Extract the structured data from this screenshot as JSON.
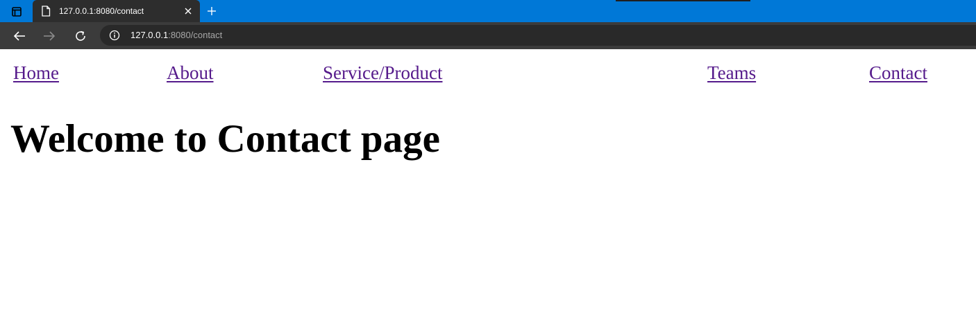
{
  "browser": {
    "tab": {
      "title": "127.0.0.1:8080/contact",
      "page_icon": "document-icon",
      "close_icon": "close-icon"
    },
    "new_tab_icon": "plus-icon",
    "tab_actions_icon": "tab-actions-icon",
    "nav": {
      "back_icon": "arrow-left-icon",
      "forward_icon": "arrow-right-icon",
      "reload_icon": "reload-icon"
    },
    "address": {
      "info_icon": "info-icon",
      "host": "127.0.0.1",
      "path": ":8080/contact"
    },
    "colors": {
      "tabstrip": "#0078d7",
      "toolbar": "#3b3b3b",
      "visited_link": "#551a8b"
    }
  },
  "page": {
    "nav_links": [
      "Home",
      "About",
      "Service/Product",
      "Teams",
      "Contact"
    ],
    "heading": "Welcome to Contact page"
  }
}
